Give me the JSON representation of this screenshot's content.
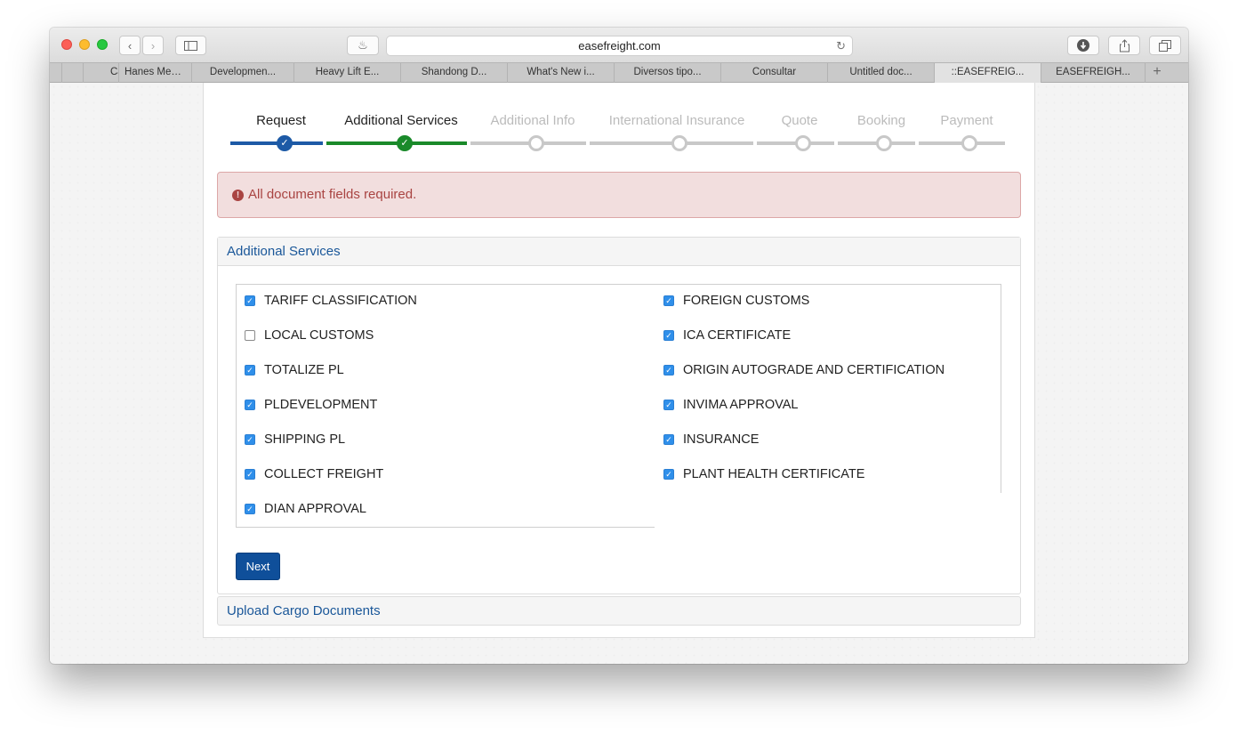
{
  "browser": {
    "url": "easefreight.com",
    "tabs": [
      {
        "label": "Ca",
        "active": false
      },
      {
        "label": "Hanes Men's...",
        "active": false
      },
      {
        "label": "Developmen...",
        "active": false
      },
      {
        "label": "Heavy Lift E...",
        "active": false
      },
      {
        "label": "Shandong D...",
        "active": false
      },
      {
        "label": "What's New i...",
        "active": false
      },
      {
        "label": "Diversos tipo...",
        "active": false
      },
      {
        "label": "Consultar",
        "active": false
      },
      {
        "label": "Untitled doc...",
        "active": false
      },
      {
        "label": "::EASEFREIG...",
        "active": true
      },
      {
        "label": "EASEFREIGH...",
        "active": false
      }
    ],
    "new_tab_label": "+"
  },
  "steps": [
    {
      "label": "Request",
      "status": "complete-blue"
    },
    {
      "label": "Additional Services",
      "status": "complete-green"
    },
    {
      "label": "Additional Info",
      "status": "pending"
    },
    {
      "label": "International Insurance",
      "status": "pending"
    },
    {
      "label": "Quote",
      "status": "pending"
    },
    {
      "label": "Booking",
      "status": "pending"
    },
    {
      "label": "Payment",
      "status": "pending"
    }
  ],
  "alert": {
    "icon": "exclamation-icon",
    "text": "All document fields required.",
    "color": "#a94442"
  },
  "additional_services": {
    "title": "Additional Services",
    "left": [
      {
        "label": "TARIFF CLASSIFICATION",
        "checked": true
      },
      {
        "label": "LOCAL CUSTOMS",
        "checked": false
      },
      {
        "label": "TOTALIZE PL",
        "checked": true
      },
      {
        "label": "PLDEVELOPMENT",
        "checked": true
      },
      {
        "label": "SHIPPING PL",
        "checked": true
      },
      {
        "label": "COLLECT FREIGHT",
        "checked": true
      },
      {
        "label": "DIAN APPROVAL",
        "checked": true
      }
    ],
    "right": [
      {
        "label": "FOREIGN CUSTOMS",
        "checked": true
      },
      {
        "label": "ICA CERTIFICATE",
        "checked": true
      },
      {
        "label": "ORIGIN AUTOGRADE AND CERTIFICATION",
        "checked": true
      },
      {
        "label": "INVIMA APPROVAL",
        "checked": true
      },
      {
        "label": "INSURANCE",
        "checked": true
      },
      {
        "label": "PLANT HEALTH CERTIFICATE",
        "checked": true
      }
    ],
    "next_label": "Next"
  },
  "upload_section": {
    "title": "Upload Cargo Documents"
  },
  "colors": {
    "accent_blue": "#1d5aa6",
    "accent_green": "#1a8a2a",
    "button": "#0f4f9a",
    "link": "#1a5799"
  }
}
